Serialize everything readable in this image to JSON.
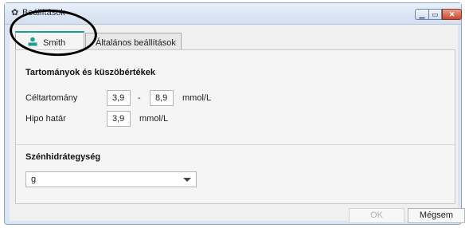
{
  "window": {
    "title": "Beállítások",
    "title_icon": "gear-icon",
    "controls": {
      "minimize": "minimize-icon",
      "maximize": "maximize-icon",
      "close": "close-icon"
    }
  },
  "tabs": [
    {
      "label": "Smith",
      "icon": "person-icon",
      "active": true,
      "accent_color": "#1aa08f"
    },
    {
      "label": "Általános beállítások",
      "active": false
    }
  ],
  "ranges": {
    "heading": "Tartományok és küszöbértékek",
    "target": {
      "label": "Céltartomány",
      "low": "3,9",
      "separator": "-",
      "high": "8,9",
      "unit": "mmol/L"
    },
    "hypo": {
      "label": "Hipo határ",
      "value": "3,9",
      "unit": "mmol/L"
    }
  },
  "carbs": {
    "heading": "Szénhidrátegység",
    "selected": "g"
  },
  "buttons": {
    "ok": "OK",
    "cancel": "Mégsem"
  }
}
